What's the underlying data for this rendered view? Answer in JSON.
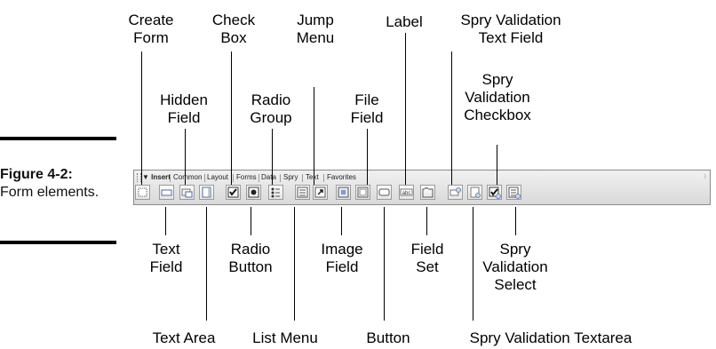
{
  "figure": {
    "number": "Figure 4-2:",
    "caption": "Form elements."
  },
  "toolbar": {
    "tabs": [
      "Insert",
      "Common",
      "Layout",
      "Forms",
      "Data",
      "Spry",
      "Text",
      "Favorites"
    ],
    "active_tab": "Insert"
  },
  "callouts": {
    "create_form": "Create\nForm",
    "check_box": "Check\nBox",
    "jump_menu": "Jump\nMenu",
    "label": "Label",
    "spry_validation_text_field": "Spry Validation\nText Field",
    "hidden_field": "Hidden\nField",
    "radio_group": "Radio\nGroup",
    "file_field": "File\nField",
    "spry_validation_checkbox": "Spry\nValidation\nCheckbox",
    "text_field": "Text\nField",
    "radio_button": "Radio\nButton",
    "image_field": "Image\nField",
    "field_set": "Field\nSet",
    "spry_validation_select": "Spry\nValidation\nSelect",
    "text_area": "Text Area",
    "list_menu": "List Menu",
    "button": "Button",
    "spry_validation_textarea": "Spry Validation Textarea"
  },
  "icons": [
    "create-form-icon",
    "text-field-icon",
    "hidden-field-icon",
    "text-area-icon",
    "check-box-icon",
    "radio-button-icon",
    "radio-group-icon",
    "list-menu-icon",
    "jump-menu-icon",
    "image-field-icon",
    "file-field-icon",
    "button-icon",
    "label-icon",
    "field-set-icon",
    "spry-validation-text-field-icon",
    "spry-validation-textarea-icon",
    "spry-validation-checkbox-icon",
    "spry-validation-select-icon"
  ]
}
